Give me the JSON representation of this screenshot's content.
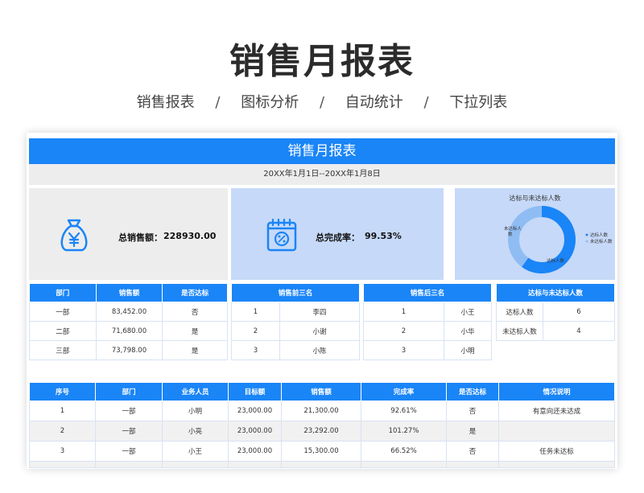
{
  "title": "销售月报表",
  "nav": {
    "items": [
      "销售报表",
      "图标分析",
      "自动统计",
      "下拉列表"
    ],
    "separator": "/"
  },
  "sheet": {
    "header": "销售月报表",
    "date_range": "20XX年1月1日--20XX年1月8日",
    "kpis": {
      "total_sales": {
        "label": "总销售额：",
        "value": "228930.00",
        "icon": "money-bag-icon"
      },
      "completion": {
        "label": "总完成率：",
        "value": "99.53%",
        "icon": "percent-calendar-icon"
      },
      "donut": {
        "title": "达标与未达标人数",
        "slices": [
          {
            "name": "达标人数",
            "value": 6,
            "color": "#1a85f7"
          },
          {
            "name": "未达标人数",
            "value": 4,
            "color": "#8fbdf3"
          }
        ],
        "legend": [
          "达标人数",
          "未达标人数"
        ],
        "inner_labels": [
          "未达标人",
          "数",
          "达标人数"
        ]
      }
    },
    "dept_table": {
      "headers": [
        "部门",
        "销售额",
        "是否达标"
      ],
      "rows": [
        [
          "一部",
          "83,452.00",
          "否"
        ],
        [
          "二部",
          "71,680.00",
          "是"
        ],
        [
          "三部",
          "73,798.00",
          "是"
        ]
      ]
    },
    "top3_table": {
      "header": "销售前三名",
      "rows": [
        [
          "1",
          "李四"
        ],
        [
          "2",
          "小谢"
        ],
        [
          "3",
          "小陈"
        ]
      ]
    },
    "bottom3_table": {
      "header": "销售后三名",
      "rows": [
        [
          "1",
          "小王"
        ],
        [
          "2",
          "小华"
        ],
        [
          "3",
          "小明"
        ]
      ]
    },
    "count_table": {
      "header": "达标与未达标人数",
      "rows": [
        [
          "达标人数",
          "6"
        ],
        [
          "未达标人数",
          "4"
        ]
      ]
    },
    "detail_table": {
      "headers": [
        "序号",
        "部门",
        "业务人员",
        "目标额",
        "销售额",
        "完成率",
        "是否达标",
        "情况说明"
      ],
      "rows": [
        [
          "1",
          "一部",
          "小明",
          "23,000.00",
          "21,300.00",
          "92.61%",
          "否",
          "有意向还未达成"
        ],
        [
          "2",
          "一部",
          "小亮",
          "23,000.00",
          "23,292.00",
          "101.27%",
          "是",
          ""
        ],
        [
          "3",
          "一部",
          "小王",
          "23,000.00",
          "15,300.00",
          "66.52%",
          "否",
          "任务未达标"
        ]
      ]
    }
  }
}
